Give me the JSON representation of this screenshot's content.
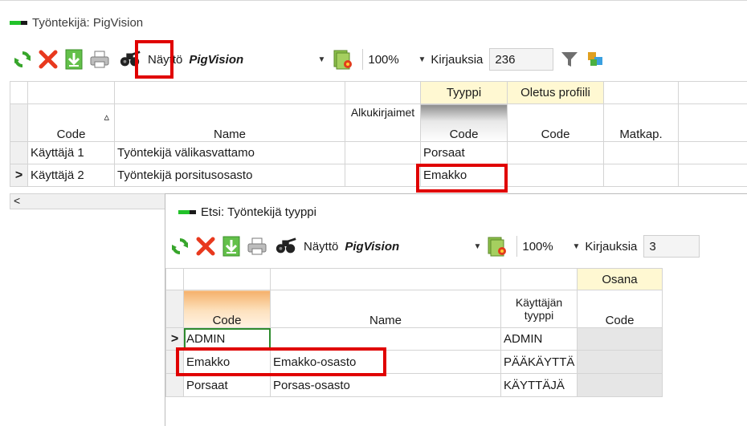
{
  "main_window": {
    "title": "Työntekijä: PigVision",
    "toolbar": {
      "display_label": "Näyttö",
      "display_value": "PigVision",
      "zoom": "100%",
      "records_label": "Kirjauksia",
      "records_count": "236"
    },
    "grid": {
      "band_headers": {
        "tyyppi": "Tyyppi",
        "oletus_profiili": "Oletus profiili"
      },
      "columns": {
        "code": "Code",
        "name": "Name",
        "alkukirjaimet": "Alkukirjaimet",
        "tyyppi_code": "Code",
        "profiili_code": "Code",
        "matkap": "Matkap."
      },
      "sort_indicator": "▵",
      "rows": [
        {
          "code": "Käyttäjä 1",
          "name": "Työntekijä välikasvattamo",
          "alkukirjaimet": "",
          "tyyppi": "Porsaat"
        },
        {
          "code": "Käyttäjä 2",
          "name": "Työntekijä porsitusosasto",
          "alkukirjaimet": "",
          "tyyppi": "Emakko",
          "selected": true
        }
      ],
      "row_indicator": ">",
      "scroll_left": "<"
    }
  },
  "search_window": {
    "title": "Etsi: Työntekijä tyyppi",
    "toolbar": {
      "display_label": "Näyttö",
      "display_value": "PigVision",
      "zoom": "100%",
      "records_label": "Kirjauksia",
      "records_count": "3"
    },
    "grid": {
      "band_headers": {
        "osana": "Osana"
      },
      "columns": {
        "code": "Code",
        "name": "Name",
        "kayttajan_tyyppi": "Käyttäjän tyyppi",
        "osana_code": "Code"
      },
      "rows": [
        {
          "code": "ADMIN",
          "name": "",
          "tyyppi": "ADMIN"
        },
        {
          "code": "Emakko",
          "name": "Emakko-osasto",
          "tyyppi": "PÄÄKÄYTTÄ"
        },
        {
          "code": "Porsaat",
          "name": "Porsas-osasto",
          "tyyppi": "KÄYTTÄJÄ"
        }
      ],
      "row_indicator": ">"
    }
  },
  "icons": [
    "refresh-icon",
    "delete-icon",
    "save-icon",
    "print-icon",
    "binoculars-icon",
    "settings-icon",
    "filter-icon",
    "paint-icon"
  ],
  "colors": {
    "highlight": "#e00000",
    "title_green": "#22c22a",
    "band_yellow": "#fff8d2",
    "active_orange": "#f5b06a"
  }
}
